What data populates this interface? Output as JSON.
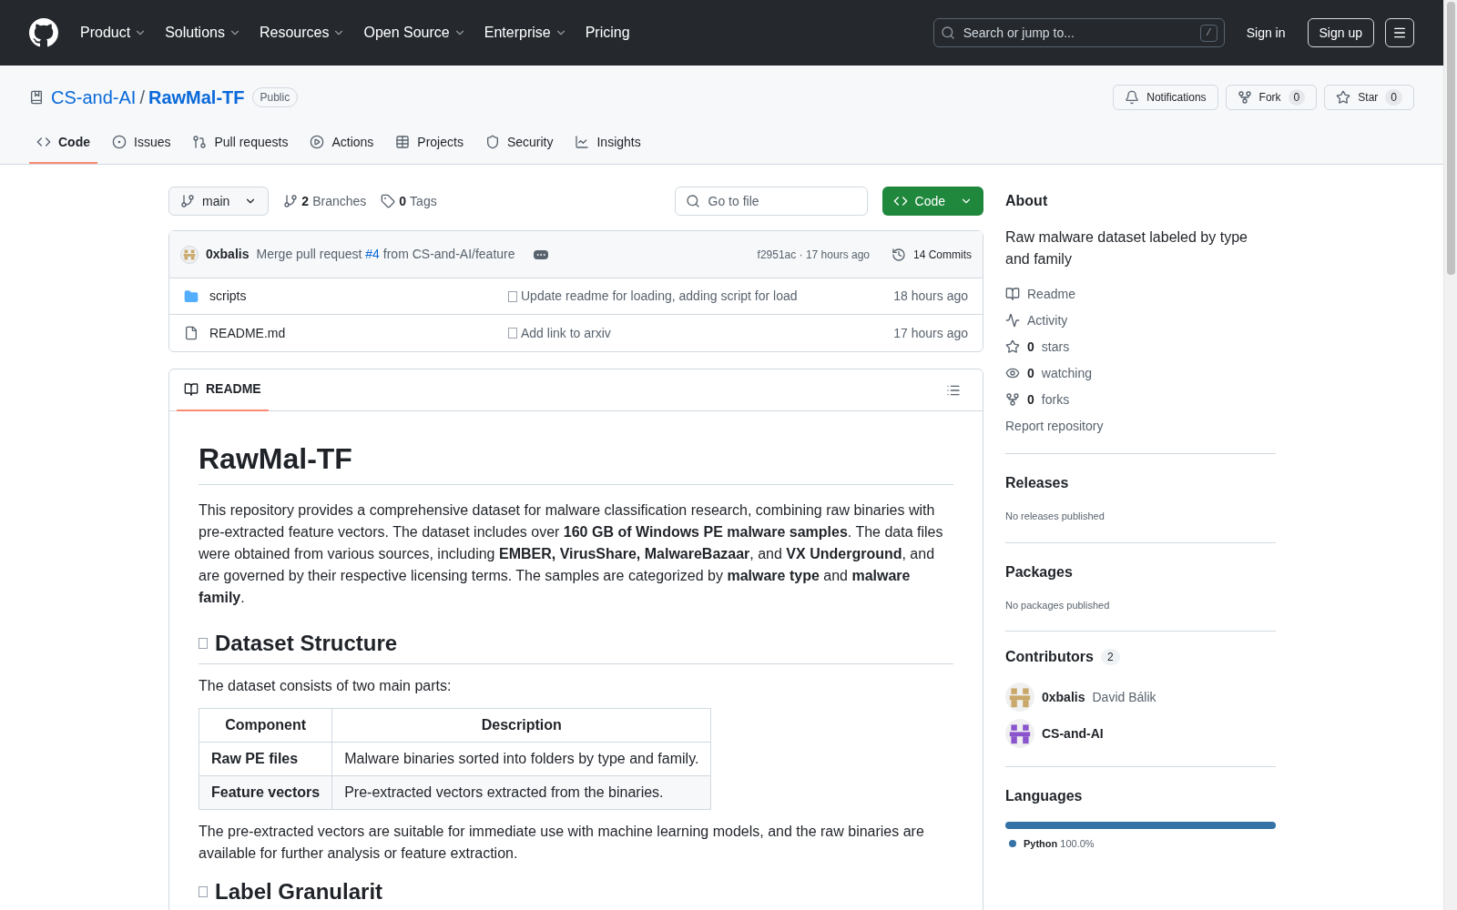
{
  "header": {
    "nav": [
      {
        "label": "Product",
        "dropdown": true
      },
      {
        "label": "Solutions",
        "dropdown": true
      },
      {
        "label": "Resources",
        "dropdown": true
      },
      {
        "label": "Open Source",
        "dropdown": true
      },
      {
        "label": "Enterprise",
        "dropdown": true
      },
      {
        "label": "Pricing",
        "dropdown": false
      }
    ],
    "search": {
      "placeholder": "Search or jump to...",
      "shortcut": "/"
    },
    "sign_in": "Sign in",
    "sign_up": "Sign up"
  },
  "repo": {
    "owner": "CS-and-AI",
    "separator": "/",
    "name": "RawMal-TF",
    "visibility": "Public",
    "actions": [
      {
        "kind": "notifications",
        "label": "Notifications"
      },
      {
        "kind": "fork",
        "label": "Fork",
        "count": "0"
      },
      {
        "kind": "star",
        "label": "Star",
        "count": "0"
      }
    ],
    "tabs": [
      {
        "kind": "code",
        "label": "Code",
        "selected": true
      },
      {
        "kind": "issues",
        "label": "Issues",
        "selected": false
      },
      {
        "kind": "pulls",
        "label": "Pull requests",
        "selected": false
      },
      {
        "kind": "actions",
        "label": "Actions",
        "selected": false
      },
      {
        "kind": "projects",
        "label": "Projects",
        "selected": false
      },
      {
        "kind": "security",
        "label": "Security",
        "selected": false
      },
      {
        "kind": "insights",
        "label": "Insights",
        "selected": false
      }
    ]
  },
  "toolbar": {
    "branch": "main",
    "branches_count": "2",
    "branches_label": "Branches",
    "tags_count": "0",
    "tags_label": "Tags",
    "go_to_file": {
      "placeholder": "Go to file"
    },
    "code_button": "Code"
  },
  "latest_commit": {
    "author": "0xbalis",
    "message_before": "Merge pull request",
    "pr": "#4",
    "message_after": "from CS-and-AI/feature",
    "hash": "f2951ac · 17 hours ago",
    "commits": "14 Commits"
  },
  "files": [
    {
      "kind": "folder",
      "name": "scripts",
      "message": "Update readme for loading, adding script for load",
      "time": "18 hours ago"
    },
    {
      "kind": "file",
      "name": "README.md",
      "message": "Add link to arxiv",
      "time": "17 hours ago"
    }
  ],
  "readme": {
    "tab": "README",
    "title": "RawMal-TF",
    "intro": "This repository provides a comprehensive dataset for malware classification research, combining raw binaries with pre-extracted feature vectors. The dataset includes over **160 GB of Windows PE malware samples**. The data files were obtained from various sources, including **EMBER, VirusShare, MalwareBazaar**, and **VX Underground**, and are governed by their respective licensing terms. The samples are categorized by **malware type** and **malware family**.",
    "section": "Dataset Structure",
    "section_intro": "The dataset consists of two main parts:",
    "table": {
      "columns": [
        "Component",
        "Description"
      ],
      "rows": [
        [
          "Raw PE files",
          "Malware binaries sorted into folders by type and family."
        ],
        [
          "Feature vectors",
          "Pre-extracted vectors extracted from the binaries."
        ]
      ]
    },
    "outro": "The pre-extracted vectors are suitable for immediate use with machine learning models, and the raw binaries are available for further analysis or feature extraction.",
    "next_section": "Label Granularit"
  },
  "sidebar": {
    "about_title": "About",
    "description": "Raw malware dataset labeled by type and family",
    "links": [
      {
        "kind": "readme",
        "label": "Readme"
      },
      {
        "kind": "activity",
        "label": "Activity"
      },
      {
        "kind": "stars",
        "count": "0",
        "label": "stars"
      },
      {
        "kind": "watching",
        "count": "0",
        "label": "watching"
      },
      {
        "kind": "forks",
        "count": "0",
        "label": "forks"
      }
    ],
    "report": "Report repository",
    "releases": {
      "title": "Releases",
      "empty": "No releases published"
    },
    "packages": {
      "title": "Packages",
      "empty": "No packages published"
    },
    "contributors": {
      "title": "Contributors",
      "count": "2",
      "people": [
        {
          "login": "0xbalis",
          "name": "David Bálik",
          "color": "#c9a86a"
        },
        {
          "login": "CS-and-AI",
          "color": "#8a55cc"
        }
      ]
    },
    "languages": {
      "title": "Languages",
      "items": [
        {
          "name": "Python",
          "percent": "100.0%",
          "level": 1,
          "color": "#3572a5"
        }
      ]
    }
  }
}
